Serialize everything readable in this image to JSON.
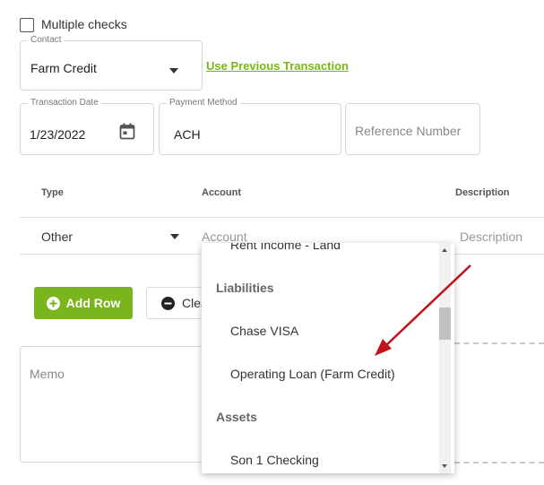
{
  "multiple_checks": {
    "label": "Multiple checks",
    "checked": false
  },
  "contact": {
    "label": "Contact",
    "value": "Farm Credit"
  },
  "use_previous_link": "Use Previous Transaction",
  "transaction_date": {
    "label": "Transaction Date",
    "value": "1/23/2022"
  },
  "payment_method": {
    "label": "Payment Method",
    "value": "ACH"
  },
  "reference_number": {
    "placeholder": "Reference Number"
  },
  "table": {
    "headers": {
      "type": "Type",
      "account": "Account",
      "description": "Description"
    },
    "row": {
      "type": "Other",
      "account_placeholder": "Account",
      "description_placeholder": "Description"
    }
  },
  "buttons": {
    "add_row": "Add Row",
    "clear": "Clear"
  },
  "memo": {
    "placeholder": "Memo"
  },
  "dropdown": {
    "partial_item": "Rent Income - Land",
    "group_liabilities": "Liabilities",
    "item_chase": "Chase VISA",
    "item_operating_loan": "Operating Loan (Farm Credit)",
    "group_assets": "Assets",
    "item_son_checking": "Son 1 Checking"
  },
  "colors": {
    "accent_green": "#7ab51d",
    "annotation_arrow": "#c0141b"
  }
}
